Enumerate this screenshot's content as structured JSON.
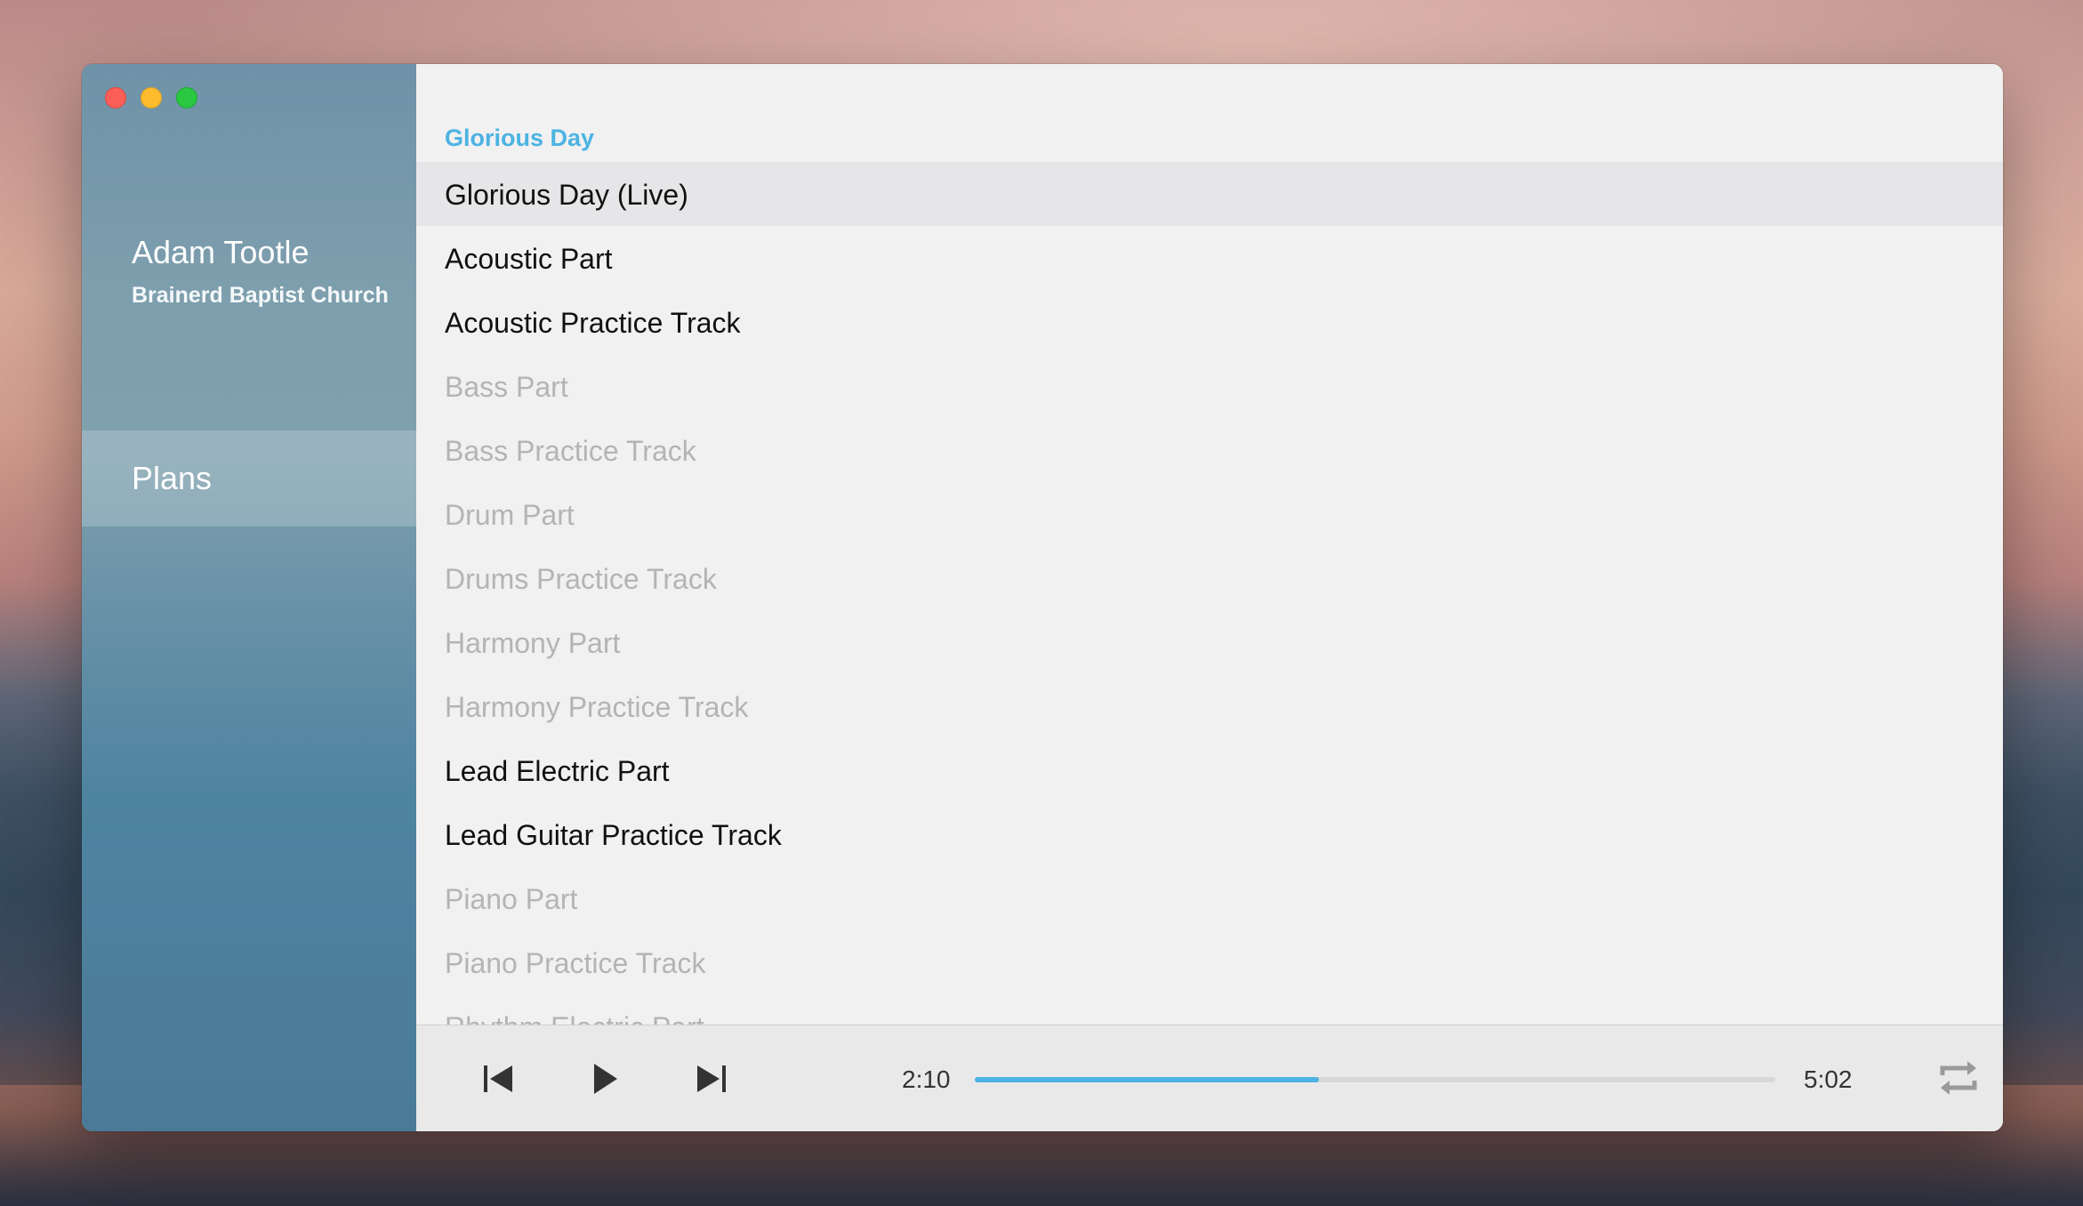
{
  "window": {
    "user": {
      "name": "Adam Tootle",
      "organization": "Brainerd Baptist Church"
    },
    "nav": {
      "items": [
        {
          "label": "Plans",
          "selected": true
        }
      ]
    }
  },
  "main": {
    "section_title": "Glorious Day",
    "tracks": [
      {
        "label": "Glorious Day (Live)",
        "enabled": true,
        "selected": true
      },
      {
        "label": "Acoustic Part",
        "enabled": true,
        "selected": false
      },
      {
        "label": "Acoustic Practice Track",
        "enabled": true,
        "selected": false
      },
      {
        "label": "Bass Part",
        "enabled": false,
        "selected": false
      },
      {
        "label": "Bass Practice Track",
        "enabled": false,
        "selected": false
      },
      {
        "label": "Drum Part",
        "enabled": false,
        "selected": false
      },
      {
        "label": "Drums Practice Track",
        "enabled": false,
        "selected": false
      },
      {
        "label": "Harmony Part",
        "enabled": false,
        "selected": false
      },
      {
        "label": "Harmony Practice Track",
        "enabled": false,
        "selected": false
      },
      {
        "label": "Lead Electric Part",
        "enabled": true,
        "selected": false
      },
      {
        "label": "Lead Guitar Practice Track",
        "enabled": true,
        "selected": false
      },
      {
        "label": "Piano Part",
        "enabled": false,
        "selected": false
      },
      {
        "label": "Piano Practice Track",
        "enabled": false,
        "selected": false
      },
      {
        "label": "Rhythm Electric Part",
        "enabled": false,
        "selected": false
      }
    ]
  },
  "player": {
    "elapsed": "2:10",
    "duration": "5:02",
    "progress_fraction": 0.43,
    "icons": {
      "previous": "skip-previous-icon",
      "play": "play-icon",
      "next": "skip-next-icon",
      "repeat": "repeat-icon"
    }
  },
  "colors": {
    "accent": "#4cb3e2",
    "sidebar_top": "#6e92a8",
    "sidebar_bottom": "#4a7a98",
    "text_enabled": "#111111",
    "text_disabled": "#b4b4b6"
  }
}
